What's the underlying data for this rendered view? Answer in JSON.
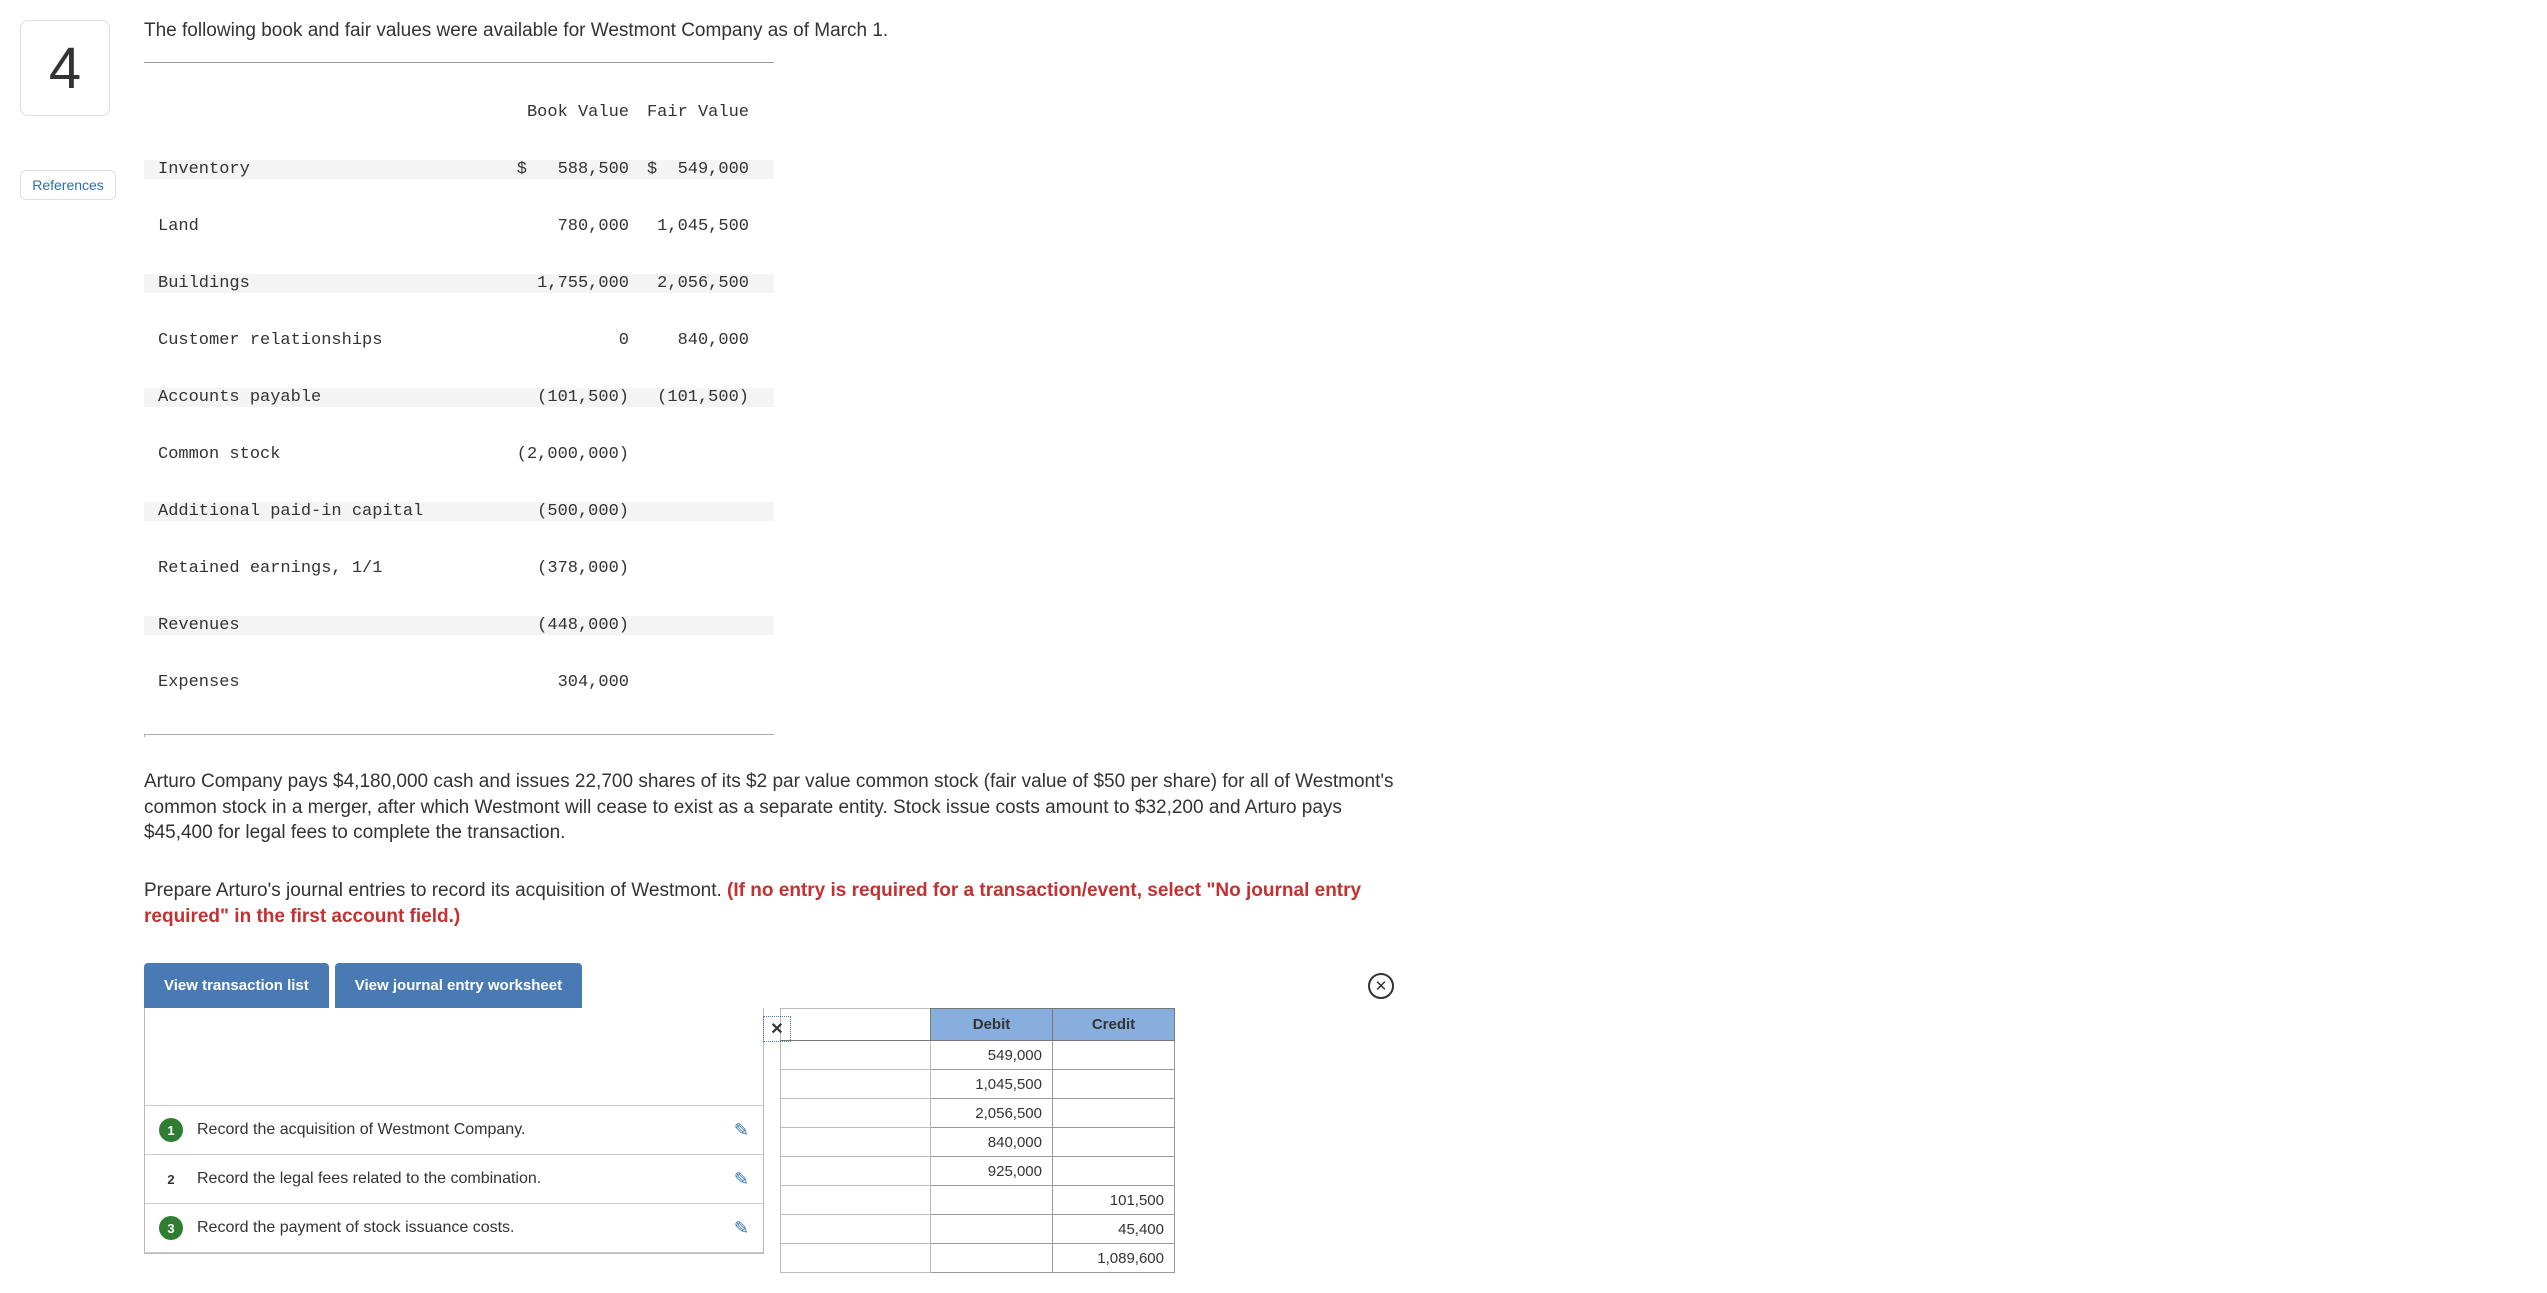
{
  "sidebar": {
    "question_number": "4",
    "references_label": "References"
  },
  "prompt_intro": "The following book and fair values were available for Westmont Company as of March 1.",
  "bv_fv_header": {
    "col1": "Book Value",
    "col2": "Fair Value"
  },
  "bv_fv_rows": [
    {
      "label": "Inventory",
      "bv": "$   588,500",
      "fv": "$  549,000"
    },
    {
      "label": "Land",
      "bv": "780,000",
      "fv": "1,045,500"
    },
    {
      "label": "Buildings",
      "bv": "1,755,000",
      "fv": "2,056,500"
    },
    {
      "label": "Customer relationships",
      "bv": "0",
      "fv": "840,000"
    },
    {
      "label": "Accounts payable",
      "bv": "(101,500)",
      "fv": "(101,500)"
    },
    {
      "label": "Common stock",
      "bv": "(2,000,000)",
      "fv": ""
    },
    {
      "label": "Additional paid-in capital",
      "bv": "(500,000)",
      "fv": ""
    },
    {
      "label": "Retained earnings, 1/1",
      "bv": "(378,000)",
      "fv": ""
    },
    {
      "label": "Revenues",
      "bv": "(448,000)",
      "fv": ""
    },
    {
      "label": "Expenses",
      "bv": "304,000",
      "fv": ""
    }
  ],
  "para1": "Arturo Company pays $4,180,000 cash and issues 22,700 shares of its $2 par value common stock (fair value of $50 per share) for all of Westmont's common stock in a merger, after which Westmont will cease to exist as a separate entity. Stock issue costs amount to $32,200 and Arturo pays $45,400 for legal fees to complete the transaction.",
  "para2_a": "Prepare Arturo's journal entries to record its acquisition of Westmont. ",
  "para2_b": "(If no entry is required for a transaction/event, select \"No journal entry required\" in the first account field.)",
  "tabs": {
    "t1": "View transaction list",
    "t2": "View journal entry worksheet"
  },
  "tlist": [
    {
      "num": "1",
      "done": true,
      "text": "Record the acquisition of Westmont Company."
    },
    {
      "num": "2",
      "done": false,
      "text": "Record the legal fees related to the combination."
    },
    {
      "num": "3",
      "done": true,
      "text": "Record the payment of stock issuance costs."
    }
  ],
  "dc_headers": {
    "debit": "Debit",
    "credit": "Credit"
  },
  "dc_rows": [
    {
      "debit": "549,000",
      "credit": ""
    },
    {
      "debit": "1,045,500",
      "credit": ""
    },
    {
      "debit": "2,056,500",
      "credit": ""
    },
    {
      "debit": "840,000",
      "credit": ""
    },
    {
      "debit": "925,000",
      "credit": ""
    },
    {
      "debit": "",
      "credit": "101,500"
    },
    {
      "debit": "",
      "credit": "45,400"
    },
    {
      "debit": "",
      "credit": "1,089,600"
    }
  ]
}
